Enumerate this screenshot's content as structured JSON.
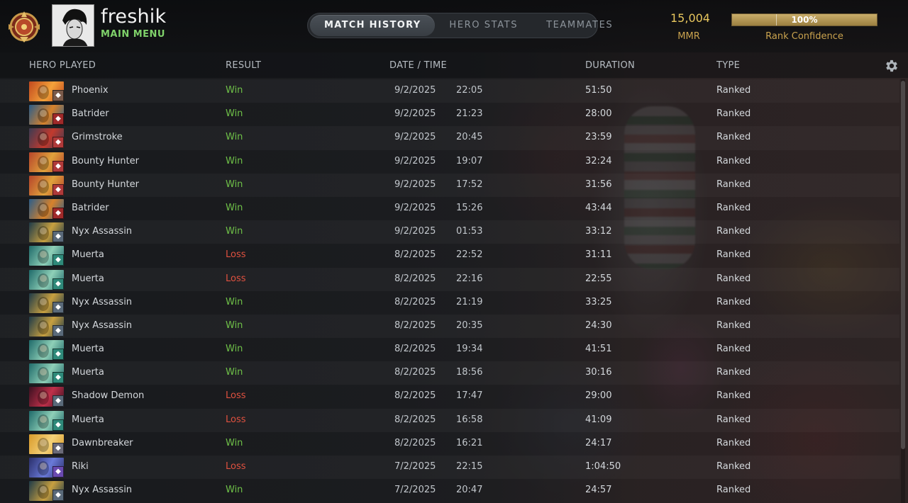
{
  "header": {
    "username": "freshik",
    "main_menu": "MAIN MENU",
    "tabs": [
      {
        "label": "MATCH HISTORY",
        "active": true
      },
      {
        "label": "HERO STATS",
        "active": false
      },
      {
        "label": "TEAMMATES",
        "active": false
      }
    ],
    "mmr_value": "15,004",
    "mmr_label": "MMR",
    "rank_confidence_value": "100%",
    "rank_confidence_fraction": 1.0,
    "rank_confidence_label": "Rank Confidence"
  },
  "columns": {
    "hero": "HERO PLAYED",
    "result": "RESULT",
    "datetime": "DATE / TIME",
    "duration": "DURATION",
    "type": "TYPE"
  },
  "colors": {
    "win": "#6fc148",
    "loss": "#e0513f",
    "accent_gold": "#e8c75e",
    "main_menu_green": "#7fd16a"
  },
  "matches": [
    {
      "hero": "Phoenix",
      "result": "Win",
      "date": "9/2/2025",
      "time": "22:05",
      "duration": "51:50",
      "type": "Ranked",
      "icon": "phoenix-portrait",
      "badge": "hard-support-icon",
      "c1": "#c2491e",
      "c2": "#f3a23a",
      "bc": "#7a5a4a"
    },
    {
      "hero": "Batrider",
      "result": "Win",
      "date": "9/2/2025",
      "time": "21:23",
      "duration": "28:00",
      "type": "Ranked",
      "icon": "batrider-portrait",
      "badge": "offlane-icon",
      "c1": "#2b5d8a",
      "c2": "#d8822b",
      "bc": "#a02a2a"
    },
    {
      "hero": "Grimstroke",
      "result": "Win",
      "date": "9/2/2025",
      "time": "20:45",
      "duration": "23:59",
      "type": "Ranked",
      "icon": "grimstroke-portrait",
      "badge": "support-icon",
      "c1": "#3b3b52",
      "c2": "#c23a2e",
      "bc": "#b03a3a"
    },
    {
      "hero": "Bounty Hunter",
      "result": "Win",
      "date": "9/2/2025",
      "time": "19:07",
      "duration": "32:24",
      "type": "Ranked",
      "icon": "bounty-hunter-portrait",
      "badge": "support-icon",
      "c1": "#b6452a",
      "c2": "#e0a23c",
      "bc": "#b03a3a"
    },
    {
      "hero": "Bounty Hunter",
      "result": "Win",
      "date": "9/2/2025",
      "time": "17:52",
      "duration": "31:56",
      "type": "Ranked",
      "icon": "bounty-hunter-portrait",
      "badge": "support-icon",
      "c1": "#b6452a",
      "c2": "#e0a23c",
      "bc": "#b03a3a"
    },
    {
      "hero": "Batrider",
      "result": "Win",
      "date": "9/2/2025",
      "time": "15:26",
      "duration": "43:44",
      "type": "Ranked",
      "icon": "batrider-portrait",
      "badge": "offlane-icon",
      "c1": "#2b5d8a",
      "c2": "#d8822b",
      "bc": "#a02a2a"
    },
    {
      "hero": "Nyx Assassin",
      "result": "Win",
      "date": "9/2/2025",
      "time": "01:53",
      "duration": "33:12",
      "type": "Ranked",
      "icon": "nyx-assassin-portrait",
      "badge": "roamer-icon",
      "c1": "#1e3a48",
      "c2": "#c8a040",
      "bc": "#5a6a7a"
    },
    {
      "hero": "Muerta",
      "result": "Loss",
      "date": "8/2/2025",
      "time": "22:52",
      "duration": "31:11",
      "type": "Ranked",
      "icon": "muerta-portrait",
      "badge": "carry-icon",
      "c1": "#1f6a6a",
      "c2": "#8fd0b8",
      "bc": "#2f8a7a"
    },
    {
      "hero": "Muerta",
      "result": "Loss",
      "date": "8/2/2025",
      "time": "22:16",
      "duration": "22:55",
      "type": "Ranked",
      "icon": "muerta-portrait",
      "badge": "carry-icon",
      "c1": "#1f6a6a",
      "c2": "#8fd0b8",
      "bc": "#2f8a7a"
    },
    {
      "hero": "Nyx Assassin",
      "result": "Win",
      "date": "8/2/2025",
      "time": "21:19",
      "duration": "33:25",
      "type": "Ranked",
      "icon": "nyx-assassin-portrait",
      "badge": "roamer-icon",
      "c1": "#1e3a48",
      "c2": "#c8a040",
      "bc": "#5a6a7a"
    },
    {
      "hero": "Nyx Assassin",
      "result": "Win",
      "date": "8/2/2025",
      "time": "20:35",
      "duration": "24:30",
      "type": "Ranked",
      "icon": "nyx-assassin-portrait",
      "badge": "roamer-icon",
      "c1": "#1e3a48",
      "c2": "#c8a040",
      "bc": "#5a6a7a"
    },
    {
      "hero": "Muerta",
      "result": "Win",
      "date": "8/2/2025",
      "time": "19:34",
      "duration": "41:51",
      "type": "Ranked",
      "icon": "muerta-portrait",
      "badge": "carry-icon",
      "c1": "#1f6a6a",
      "c2": "#8fd0b8",
      "bc": "#2f8a7a"
    },
    {
      "hero": "Muerta",
      "result": "Win",
      "date": "8/2/2025",
      "time": "18:56",
      "duration": "30:16",
      "type": "Ranked",
      "icon": "muerta-portrait",
      "badge": "carry-icon",
      "c1": "#1f6a6a",
      "c2": "#8fd0b8",
      "bc": "#2f8a7a"
    },
    {
      "hero": "Shadow Demon",
      "result": "Loss",
      "date": "8/2/2025",
      "time": "17:47",
      "duration": "29:00",
      "type": "Ranked",
      "icon": "shadow-demon-portrait",
      "badge": "support-icon",
      "c1": "#3a1020",
      "c2": "#c0304a",
      "bc": "#5a6a7a"
    },
    {
      "hero": "Muerta",
      "result": "Loss",
      "date": "8/2/2025",
      "time": "16:58",
      "duration": "41:09",
      "type": "Ranked",
      "icon": "muerta-portrait",
      "badge": "carry-icon",
      "c1": "#1f6a6a",
      "c2": "#8fd0b8",
      "bc": "#2f8a7a"
    },
    {
      "hero": "Dawnbreaker",
      "result": "Win",
      "date": "8/2/2025",
      "time": "16:21",
      "duration": "24:17",
      "type": "Ranked",
      "icon": "dawnbreaker-portrait",
      "badge": "offlane-icon",
      "c1": "#d89a2a",
      "c2": "#f4d27a",
      "bc": "#6a6a78"
    },
    {
      "hero": "Riki",
      "result": "Loss",
      "date": "7/2/2025",
      "time": "22:15",
      "duration": "1:04:50",
      "type": "Ranked",
      "icon": "riki-portrait",
      "badge": "roamer-icon",
      "c1": "#2a2f6a",
      "c2": "#6a7ad8",
      "bc": "#6a4ab0"
    },
    {
      "hero": "Nyx Assassin",
      "result": "Win",
      "date": "7/2/2025",
      "time": "20:47",
      "duration": "24:57",
      "type": "Ranked",
      "icon": "nyx-assassin-portrait",
      "badge": "roamer-icon",
      "c1": "#1e3a48",
      "c2": "#c8a040",
      "bc": "#5a6a7a"
    }
  ]
}
